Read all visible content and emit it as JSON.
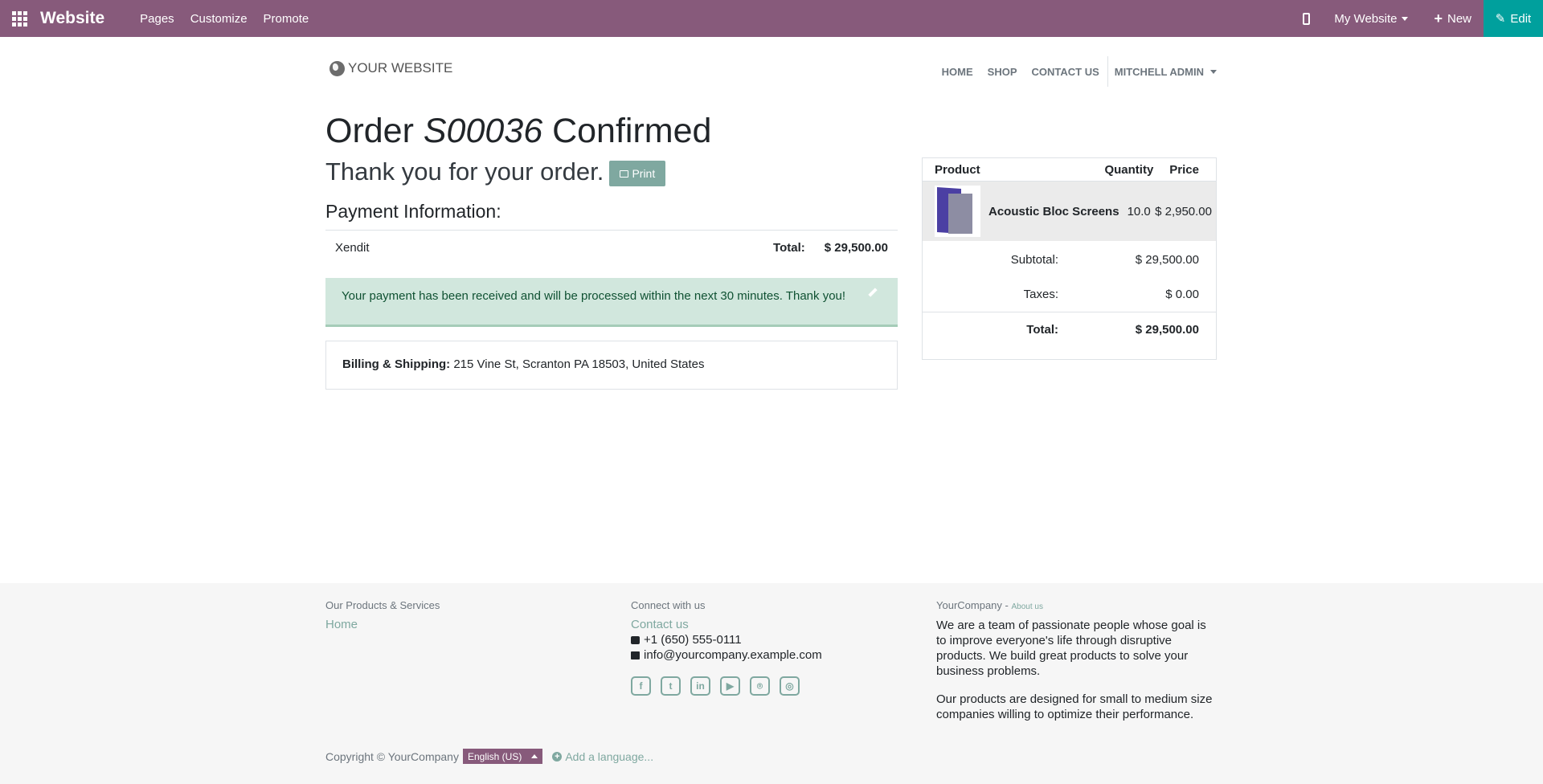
{
  "topbar": {
    "brand": "Website",
    "menu": [
      "Pages",
      "Customize",
      "Promote"
    ],
    "site_select": "My Website",
    "new_label": "New",
    "edit_label": "Edit",
    "color": "#875a7b",
    "edit_color": "#00a09d"
  },
  "header": {
    "logo_text": "YOUR WEBSITE",
    "nav": [
      "HOME",
      "SHOP",
      "CONTACT US"
    ],
    "user": "MITCHELL ADMIN"
  },
  "order": {
    "title_prefix": "Order",
    "order_number": "S00036",
    "title_suffix": "Confirmed",
    "thanks": "Thank you for your order.",
    "print_label": "Print",
    "payment_heading": "Payment Information:",
    "payment_method": "Xendit",
    "total_label": "Total:",
    "total_value": "$ 29,500.00",
    "alert_text": "Your payment has been received and will be processed within the next 30 minutes. Thank you!",
    "billing_label": "Billing & Shipping:",
    "billing_address": "215 Vine St, Scranton PA 18503, United States"
  },
  "cart": {
    "headers": {
      "product": "Product",
      "quantity": "Quantity",
      "price": "Price"
    },
    "item": {
      "name": "Acoustic Bloc Screens",
      "quantity": "10.0",
      "price": "$ 2,950.00"
    },
    "subtotal_label": "Subtotal:",
    "subtotal_value": "$ 29,500.00",
    "taxes_label": "Taxes:",
    "taxes_value": "$ 0.00",
    "total_label": "Total:",
    "total_value": "$ 29,500.00"
  },
  "footer": {
    "col1_heading": "Our Products & Services",
    "col1_link": "Home",
    "col2_heading": "Connect with us",
    "contact_link": "Contact us",
    "phone": "+1 (650) 555-0111",
    "email": "info@yourcompany.example.com",
    "socials": [
      "facebook-icon",
      "twitter-icon",
      "linkedin-icon",
      "youtube-icon",
      "github-icon",
      "instagram-icon"
    ],
    "col3_heading": "YourCompany",
    "col3_sep": " - ",
    "about_link": "About us",
    "about_p1": "We are a team of passionate people whose goal is to improve everyone's life through disruptive products. We build great products to solve your business problems.",
    "about_p2": "Our products are designed for small to medium size companies willing to optimize their performance.",
    "copyright": "Copyright © YourCompany",
    "language": "English (US)",
    "add_language": "Add a language..."
  }
}
